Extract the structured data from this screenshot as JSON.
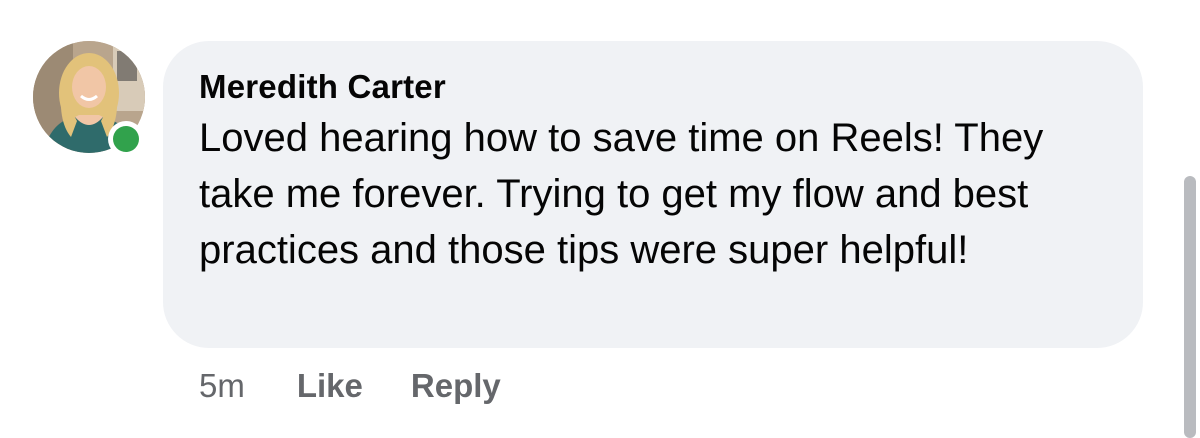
{
  "comment": {
    "author": "Meredith Carter",
    "text": "Loved hearing how to save time on Reels! They take me forever. Trying to get my flow and best practices and those tips were super helpful!",
    "timestamp": "5m",
    "actions": {
      "like_label": "Like",
      "reply_label": "Reply"
    },
    "avatar": {
      "icon": "profile-photo",
      "presence": "online"
    }
  },
  "colors": {
    "bubble": "#f0f2f5",
    "presence": "#31a24c",
    "text": "#050505",
    "secondary_text": "#65676b"
  }
}
